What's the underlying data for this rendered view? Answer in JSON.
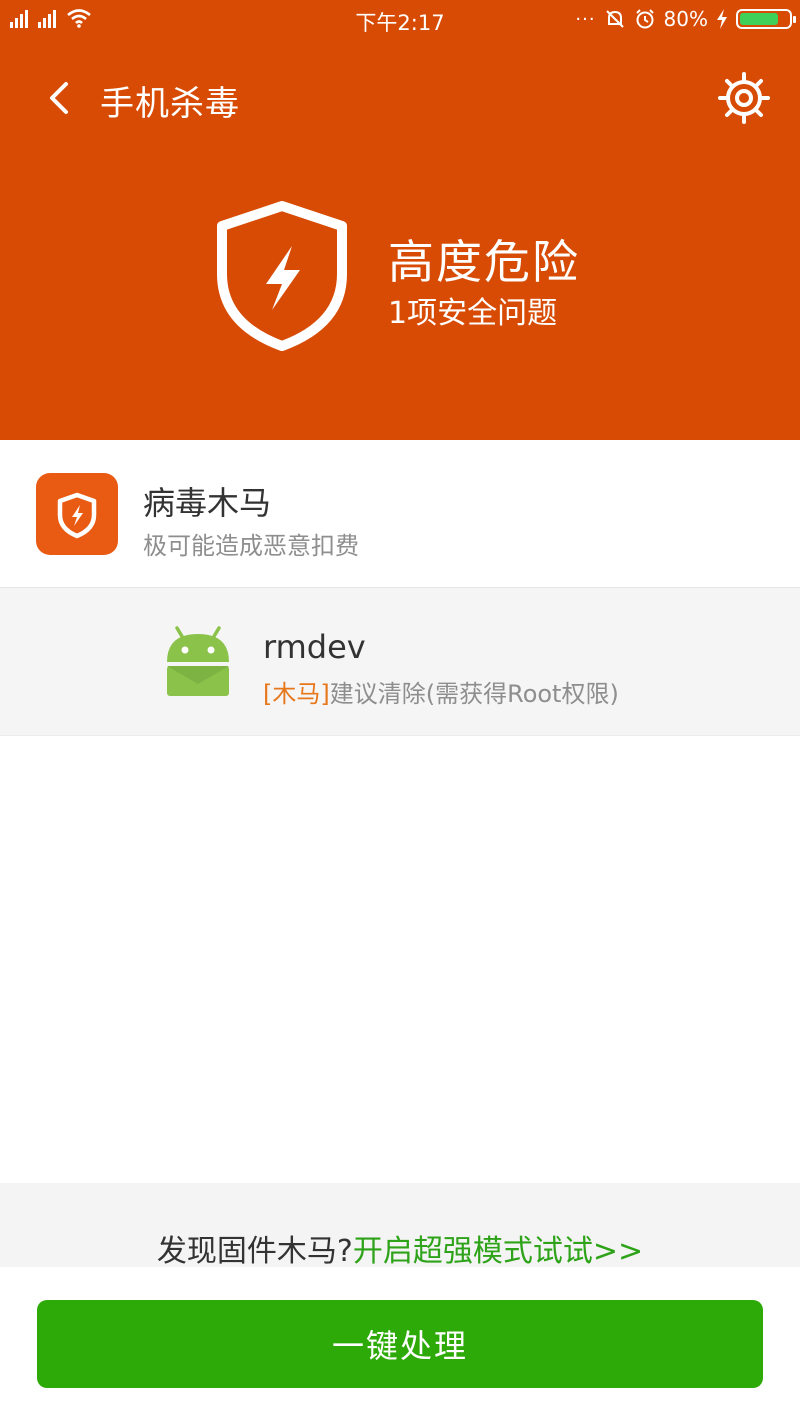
{
  "status_bar": {
    "time": "下午2:17",
    "battery": "80%",
    "battery_level": 0.8,
    "dots": "···"
  },
  "header": {
    "title": "手机杀毒",
    "level": "高度危险",
    "summary": "1项安全问题",
    "background_color": "#d84b04"
  },
  "category": {
    "title": "病毒木马",
    "subtitle": "极可能造成恶意扣费",
    "icon_color": "#e95a12"
  },
  "apps": [
    {
      "name": "rmdev",
      "tag": "[木马]",
      "advice": "建议清除(需获得Root权限)",
      "icon": "android-icon"
    }
  ],
  "footer": {
    "prompt": "发现固件木马?",
    "link": "开启超强模式试试>>",
    "action": "一键处理",
    "action_color": "#2eaa08"
  }
}
